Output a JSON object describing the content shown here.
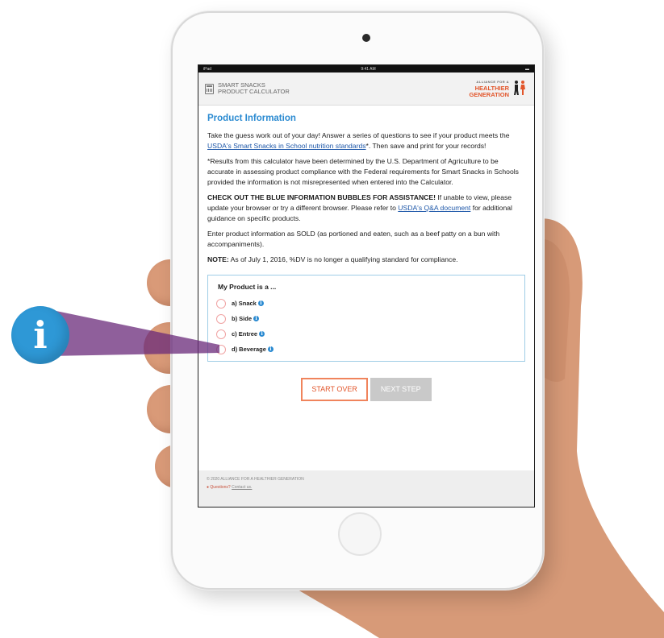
{
  "status": {
    "left": "iPad",
    "center": "9:41 AM"
  },
  "header": {
    "app_name_line1": "SMART SNACKS",
    "app_name_line2": "PRODUCT CALCULATOR",
    "logo_small": "ALLIANCE FOR A",
    "logo_line1": "HEALTHIER",
    "logo_line2": "GENERATION"
  },
  "page": {
    "title": "Product Information",
    "p1_text": "Take the guess work out of your day! Answer a series of questions to see if your product meets the ",
    "p1_link": "USDA's Smart Snacks in School nutrition standards",
    "p1_tail": "*. Then save and print for your records!",
    "p2": "*Results from this calculator have been determined by the U.S. Department of Agriculture to be accurate in assessing product compliance with the Federal requirements for Smart Snacks in Schools provided the information is not misrepresented when entered into the Calculator.",
    "p3_strong": "CHECK OUT THE BLUE INFORMATION BUBBLES FOR ASSISTANCE!",
    "p3_text": " If unable to view, please update your browser or try a different browser.  Please refer to ",
    "p3_link": "USDA's Q&A document",
    "p3_tail": " for additional guidance on specific products.",
    "p4": "Enter product information as SOLD (as portioned and eaten, such as a beef patty on a bun with accompaniments).",
    "note_label": "NOTE:",
    "note_text": " As of July 1, 2016, %DV is no longer a qualifying standard for compliance."
  },
  "product_form": {
    "question": "My Product is a ...",
    "options": [
      {
        "label": "a) Snack"
      },
      {
        "label": "b) Side"
      },
      {
        "label": "c) Entree"
      },
      {
        "label": "d) Beverage"
      }
    ]
  },
  "buttons": {
    "start_over": "START OVER",
    "next_step": "NEXT STEP"
  },
  "footer": {
    "copyright": "© 2020 ALLIANCE FOR A HEALTHIER GENERATION",
    "questions": "Questions? ",
    "contact": "Contact us."
  },
  "callout": {
    "glyph": "i"
  },
  "colors": {
    "accent_blue": "#2a8ad1",
    "accent_orange": "#e2552a",
    "callout_blue": "#2e98d6",
    "beam_purple": "#6a2a7a"
  }
}
